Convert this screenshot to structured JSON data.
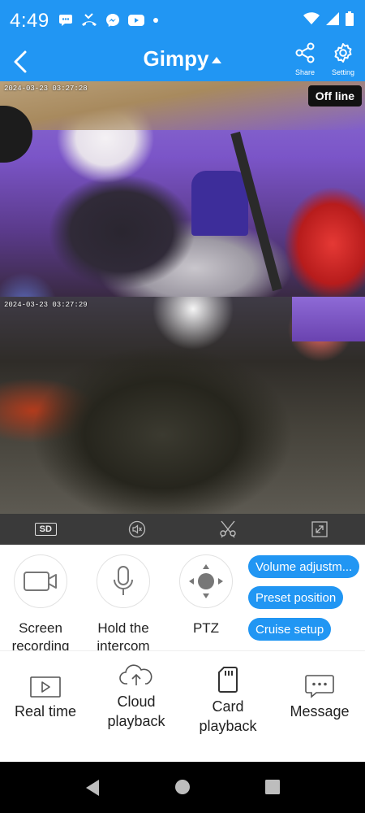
{
  "status_bar": {
    "time": "4:49",
    "left_icons": [
      "chat-bubble-icon",
      "missed-call-icon",
      "messenger-icon",
      "youtube-icon",
      "dot-icon"
    ],
    "right_icons": [
      "wifi-icon",
      "signal-icon",
      "battery-icon"
    ]
  },
  "header": {
    "title": "Gimpy",
    "share_label": "Share",
    "setting_label": "Setting"
  },
  "camera": {
    "timestamp_top": "2024-03-23 03:27:28",
    "timestamp_bottom": "2024-03-23 03:27:29",
    "status_badge": "Off line"
  },
  "video_toolbar": {
    "sd_label": "SD",
    "items": [
      "sd-quality",
      "mute-icon",
      "snapshot-icon",
      "fullscreen-icon"
    ]
  },
  "controls": {
    "screen_recording": "Screen recording",
    "hold_intercom": "Hold the intercom",
    "ptz": "PTZ",
    "volume_adjust": "Volume adjustm...",
    "preset_position": "Preset position",
    "cruise_setup": "Cruise setup"
  },
  "tabs": {
    "real_time": "Real time",
    "cloud_playback": "Cloud playback",
    "card_playback": "Card playback",
    "message": "Message"
  },
  "colors": {
    "primary": "#2196F3",
    "toolbar": "#3a3a3a",
    "nav": "#000000"
  }
}
